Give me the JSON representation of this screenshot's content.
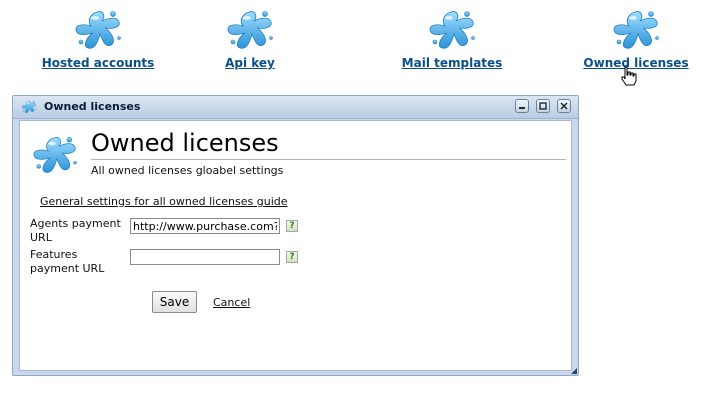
{
  "nav": {
    "items": [
      {
        "label": "Hosted accounts",
        "icon": "splash-icon"
      },
      {
        "label": "Api key",
        "icon": "splash-icon"
      },
      {
        "label": "Mail templates",
        "icon": "splash-icon"
      },
      {
        "label": "Owned licenses",
        "icon": "splash-icon"
      }
    ]
  },
  "window": {
    "title": "Owned licenses",
    "heading": "Owned licenses",
    "subtitle": "All owned licenses gloabel settings",
    "guide_link": "General settings for all owned licenses guide",
    "fields": [
      {
        "label": "Agents payment URL",
        "value": "http://www.purchase.com?licen",
        "help": "?"
      },
      {
        "label": "Features payment URL",
        "value": "",
        "help": "?"
      }
    ],
    "save_label": "Save",
    "cancel_label": "Cancel"
  },
  "colors": {
    "link": "#0b4f8a",
    "window_frame": "#c9d8ea",
    "splash_blue": "#3aa7e6"
  }
}
